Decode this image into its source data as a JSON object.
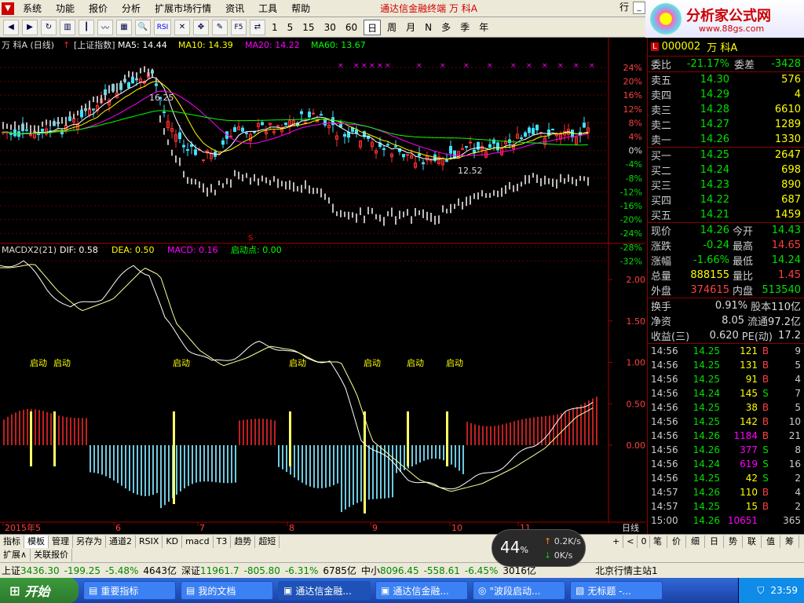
{
  "menu": {
    "items": [
      "系统",
      "功能",
      "报价",
      "分析",
      "扩展市场行情",
      "资讯",
      "工具",
      "帮助"
    ],
    "window_title": "通达信金融终端  万  科A",
    "right_label": "行"
  },
  "toolbar": {
    "periods": [
      "1",
      "5",
      "15",
      "30",
      "60",
      "日",
      "周",
      "月",
      "N",
      "多",
      "季",
      "年"
    ],
    "active_period": "日",
    "icons": [
      "back-icon",
      "forward-icon",
      "refresh-icon",
      "bar-icon",
      "kline-icon",
      "line-icon",
      "grid-icon",
      "zoom-icon",
      "rsi-icon",
      "cross-icon",
      "move-icon",
      "draw-icon",
      "f5-icon",
      "switch-icon"
    ],
    "icon_labels": {
      "rsi": "RSI",
      "f5": "F5"
    }
  },
  "logo": {
    "brand": "分析家公式网",
    "url": "www.88gs.com"
  },
  "main_chart": {
    "legend_stock": "万  科A (日线)",
    "legend_index": "[上证指数]",
    "ma5": "MA5: 14.44",
    "ma10": "MA10: 14.39",
    "ma20": "MA20: 14.22",
    "ma60": "MA60: 13.67",
    "high_label": "16.25",
    "low_label": "12.52",
    "pct_ticks": [
      "24%",
      "20%",
      "16%",
      "12%",
      "8%",
      "4%",
      "0%",
      "-4%",
      "-8%",
      "-12%",
      "-16%",
      "-20%",
      "-24%",
      "-28%",
      "-32%"
    ]
  },
  "macd_chart": {
    "legend_name": "MACDX2(21)",
    "dif": "DIF: 0.58",
    "dea": "DEA: 0.50",
    "macd": "MACD: 0.16",
    "start_point": "启动点: 0.00",
    "y_ticks": [
      "2.00",
      "1.50",
      "1.00",
      "0.50",
      "0.00"
    ],
    "start_label": "启动",
    "start_labels_count": 7
  },
  "x_axis": {
    "labels": [
      "2015年5",
      "6",
      "7",
      "8",
      "9",
      "10",
      "11"
    ],
    "period_label": "日线"
  },
  "colors": {
    "up": "#ff3030",
    "down": "#40e0ff",
    "ma5": "#ffffff",
    "ma10": "#ffff00",
    "ma20": "#ff00ff",
    "ma60": "#00ff00",
    "signal": "#ffff66",
    "frame": "#a00000"
  },
  "chart_data": {
    "type": "line",
    "series": [
      {
        "name": "MA5",
        "values": [
          14.44
        ]
      },
      {
        "name": "MA10",
        "values": [
          14.39
        ]
      },
      {
        "name": "MA20",
        "values": [
          14.22
        ]
      },
      {
        "name": "MA60",
        "values": [
          13.67
        ]
      },
      {
        "name": "DIF",
        "values": [
          0.58
        ]
      },
      {
        "name": "DEA",
        "values": [
          0.5
        ]
      },
      {
        "name": "MACD",
        "values": [
          0.16
        ]
      }
    ],
    "categories": [
      "2015年5",
      "6",
      "7",
      "8",
      "9",
      "10",
      "11"
    ],
    "macd_ylim": [
      0.0,
      2.0
    ]
  },
  "quote": {
    "code": "000002",
    "name": "万  科A",
    "wei_bi_label": "委比",
    "wei_bi": "-21.17%",
    "wei_cha_label": "委差",
    "wei_cha": "-3428",
    "asks": [
      {
        "label": "卖五",
        "price": "14.30",
        "vol": "576"
      },
      {
        "label": "卖四",
        "price": "14.29",
        "vol": "4"
      },
      {
        "label": "卖三",
        "price": "14.28",
        "vol": "6610"
      },
      {
        "label": "卖二",
        "price": "14.27",
        "vol": "1289"
      },
      {
        "label": "卖一",
        "price": "14.26",
        "vol": "1330"
      }
    ],
    "bids": [
      {
        "label": "买一",
        "price": "14.25",
        "vol": "2647"
      },
      {
        "label": "买二",
        "price": "14.24",
        "vol": "698"
      },
      {
        "label": "买三",
        "price": "14.23",
        "vol": "890"
      },
      {
        "label": "买四",
        "price": "14.22",
        "vol": "687"
      },
      {
        "label": "买五",
        "price": "14.21",
        "vol": "1459"
      }
    ],
    "stats": [
      {
        "l1": "现价",
        "v1": "14.26",
        "c1": "g",
        "l2": "今开",
        "v2": "14.43",
        "c2": "g"
      },
      {
        "l1": "涨跌",
        "v1": "-0.24",
        "c1": "g",
        "l2": "最高",
        "v2": "14.65",
        "c2": "r"
      },
      {
        "l1": "涨幅",
        "v1": "-1.66%",
        "c1": "g",
        "l2": "最低",
        "v2": "14.24",
        "c2": "g"
      },
      {
        "l1": "总量",
        "v1": "888155",
        "c1": "y",
        "l2": "量比",
        "v2": "1.45",
        "c2": "r"
      },
      {
        "l1": "外盘",
        "v1": "374615",
        "c1": "r",
        "l2": "内盘",
        "v2": "513540",
        "c2": "g"
      }
    ],
    "stats2": [
      {
        "l1": "换手",
        "v1": "0.91%",
        "l2": "股本",
        "v2": "110亿"
      },
      {
        "l1": "净资",
        "v1": "8.05",
        "l2": "流通",
        "v2": "97.2亿"
      },
      {
        "l1": "收益(三)",
        "v1": "0.620",
        "l2": "PE(动)",
        "v2": "17.2"
      }
    ],
    "ticks": [
      {
        "t": "14:56",
        "p": "14.25",
        "v": "121",
        "bs": "B",
        "n": "9"
      },
      {
        "t": "14:56",
        "p": "14.25",
        "v": "131",
        "bs": "B",
        "n": "5"
      },
      {
        "t": "14:56",
        "p": "14.25",
        "v": "91",
        "bs": "B",
        "n": "4"
      },
      {
        "t": "14:56",
        "p": "14.24",
        "v": "145",
        "bs": "S",
        "n": "7"
      },
      {
        "t": "14:56",
        "p": "14.25",
        "v": "38",
        "bs": "B",
        "n": "5"
      },
      {
        "t": "14:56",
        "p": "14.25",
        "v": "142",
        "bs": "B",
        "n": "10"
      },
      {
        "t": "14:56",
        "p": "14.26",
        "v": "1184",
        "bs": "B",
        "n": "21"
      },
      {
        "t": "14:56",
        "p": "14.26",
        "v": "377",
        "bs": "S",
        "n": "8"
      },
      {
        "t": "14:56",
        "p": "14.24",
        "v": "619",
        "bs": "S",
        "n": "16"
      },
      {
        "t": "14:56",
        "p": "14.25",
        "v": "42",
        "bs": "S",
        "n": "2"
      },
      {
        "t": "14:57",
        "p": "14.26",
        "v": "110",
        "bs": "B",
        "n": "4"
      },
      {
        "t": "14:57",
        "p": "14.25",
        "v": "15",
        "bs": "B",
        "n": "2"
      },
      {
        "t": "15:00",
        "p": "14.26",
        "v": "10651",
        "bs": "",
        "n": "365"
      }
    ],
    "bottom_tabs": [
      "笔",
      "价",
      "细",
      "日",
      "势",
      "联",
      "值",
      "筹"
    ]
  },
  "indicator_tabs": [
    "指标",
    "模板",
    "管理",
    "另存为",
    "通道2",
    "RSIX",
    "KD",
    "macd",
    "T3",
    "趋势",
    "超短"
  ],
  "active_indicator_tab": "模板",
  "chart_nav": [
    "+",
    "<",
    "0"
  ],
  "ext_bar": {
    "expand": "扩展∧",
    "linked": "关联报价"
  },
  "status": {
    "sh_label": "上证",
    "sh": "3436.30",
    "sh_chg": "-199.25",
    "sh_pct": "-5.48%",
    "sh_amt": "4643亿",
    "sz_label": "深证",
    "sz": "11961.7",
    "sz_chg": "-805.80",
    "sz_pct": "-6.31%",
    "sz_amt": "6785亿",
    "zx_label": "中小",
    "zx": "8096.45",
    "zx_chg": "-558.61",
    "zx_pct": "-6.45%",
    "zx_amt": "3016亿",
    "server": "北京行情主站1"
  },
  "speed_widget": {
    "pct": "44",
    "pct_unit": "%",
    "up": "0.2K/s",
    "down": "0K/s"
  },
  "taskbar": {
    "start": "开始",
    "tasks": [
      "重要指标",
      "我的文档",
      "通达信金融...",
      "通达信金融...",
      "\"波段启动...",
      "无标题 -..."
    ],
    "clock": "23:59"
  }
}
